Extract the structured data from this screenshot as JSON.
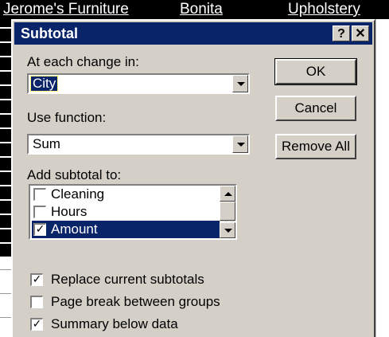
{
  "sheet": {
    "cells": [
      "Jerome's Furniture",
      "Bonita",
      "Upholstery"
    ]
  },
  "dialog": {
    "title": "Subtotal",
    "help_glyph": "?",
    "close_glyph": "✕",
    "change_label": "At each change in:",
    "change_value": "City",
    "function_label": "Use function:",
    "function_value": "Sum",
    "add_label": "Add subtotal to:",
    "list_items": [
      {
        "label": "Cleaning",
        "checked": false
      },
      {
        "label": "Hours",
        "checked": false
      },
      {
        "label": "Amount",
        "checked": true
      }
    ],
    "ok_label": "OK",
    "cancel_label": "Cancel",
    "remove_all_label": "Remove All",
    "options": [
      {
        "label": "Replace current subtotals",
        "checked": true
      },
      {
        "label": "Page break between groups",
        "checked": false
      },
      {
        "label": "Summary below data",
        "checked": true
      }
    ],
    "check_glyph": "✓",
    "colors": {
      "face": "#d4d0c8",
      "titlebar": "#0a246a",
      "selection": "#0a246a"
    }
  }
}
